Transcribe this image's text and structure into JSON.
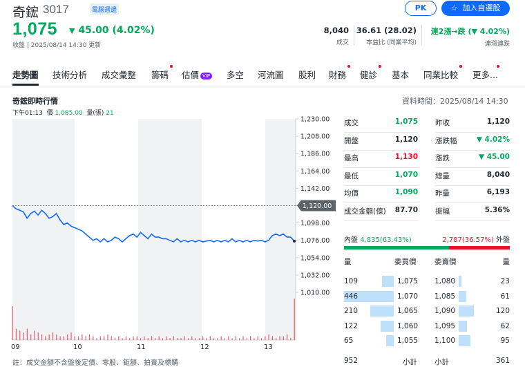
{
  "header": {
    "name": "奇鋐",
    "code": "3017",
    "tag": "電腦週邊",
    "pk_label": "PK",
    "watch_label": "加入自選股",
    "price": "1,075",
    "change": "45.00 (4.02%)",
    "update": "收盤 | 2025/08/14 14:30 更新",
    "volume_value": "8,040",
    "volume_label": "成交",
    "pe_value": "36.61 (28.02)",
    "pe_label": "本益比 (同業平均)",
    "streak_value": "連2漲→跌 (▼ 4.02%)",
    "streak_label": "連漲連跌"
  },
  "tabs": [
    "走勢圖",
    "技術分析",
    "成交彙整",
    "籌碼",
    "估價",
    "多空",
    "河流圖",
    "股利",
    "財務",
    "健診",
    "基本",
    "同業比較",
    "更多..."
  ],
  "vip_label": "VIP",
  "section": {
    "title": "奇鋐即時行情",
    "data_time": "資料時間：2025/08/14 14:30",
    "sub_time": "下午01:13",
    "sub_price_label": "價",
    "sub_price": "1,085.00",
    "sub_vol_label": "量(張)",
    "sub_vol": "21"
  },
  "chart_data": {
    "type": "line",
    "x_ticks": [
      "09",
      "10",
      "11",
      "12",
      "13"
    ],
    "y_ticks": [
      "1,230.00",
      "1,208.00",
      "1,186.00",
      "1,164.00",
      "1,142.00",
      "1,120.00",
      "1,098.00",
      "1,076.00",
      "1,054.00",
      "1,032.00",
      "1,010.00"
    ],
    "ylim": [
      1010,
      1230
    ],
    "prev_close": 1120,
    "prev_close_label": "1,120.00",
    "price_series": [
      1120,
      1116,
      1114,
      1112,
      1104,
      1110,
      1113,
      1108,
      1114,
      1110,
      1104,
      1106,
      1110,
      1102,
      1096,
      1098,
      1094,
      1092,
      1090,
      1088,
      1084,
      1080,
      1076,
      1078,
      1074,
      1078,
      1074,
      1076,
      1080,
      1078,
      1074,
      1078,
      1082,
      1084,
      1080,
      1086,
      1082,
      1078,
      1084,
      1080,
      1080,
      1078,
      1078,
      1076,
      1074,
      1078,
      1074,
      1076,
      1074,
      1076,
      1074,
      1076,
      1074,
      1075,
      1076,
      1074,
      1076,
      1074,
      1076,
      1074,
      1078,
      1074,
      1076,
      1074,
      1076,
      1074,
      1076,
      1075,
      1076,
      1074,
      1076,
      1082,
      1084,
      1082,
      1084,
      1080,
      1080,
      1075
    ],
    "volume_series": [
      18,
      6,
      5,
      4,
      6,
      3,
      5,
      4,
      3,
      2,
      3,
      4,
      3,
      2,
      2,
      3,
      4,
      2,
      2,
      3,
      2,
      3,
      2,
      1,
      2,
      2,
      3,
      2,
      1,
      2,
      1,
      2,
      1,
      2,
      2,
      1,
      2,
      1,
      2,
      1,
      2,
      1,
      2,
      1,
      2,
      1,
      1,
      2,
      1,
      2,
      1,
      1,
      2,
      1,
      2,
      1,
      1,
      2,
      1,
      2,
      1,
      2,
      1,
      2,
      1,
      2,
      1,
      2,
      1,
      2,
      3,
      2,
      1,
      2,
      2,
      3,
      1,
      22
    ]
  },
  "stats_left": [
    {
      "label": "成交",
      "value": "1,075",
      "color": "green"
    },
    {
      "label": "開盤",
      "value": "1,120",
      "color": "black"
    },
    {
      "label": "最高",
      "value": "1,130",
      "color": "red"
    },
    {
      "label": "最低",
      "value": "1,070",
      "color": "green"
    },
    {
      "label": "均價",
      "value": "1,090",
      "color": "green"
    },
    {
      "label": "成交金額(億)",
      "value": "87.70",
      "color": "black"
    }
  ],
  "stats_right": [
    {
      "label": "昨收",
      "value": "1,120",
      "color": "black"
    },
    {
      "label": "漲跌幅",
      "value": "▼ 4.02%",
      "color": "green"
    },
    {
      "label": "漲跌",
      "value": "▼ 45.00",
      "color": "green"
    },
    {
      "label": "總量",
      "value": "8,040",
      "color": "black"
    },
    {
      "label": "昨量",
      "value": "6,193",
      "color": "black"
    },
    {
      "label": "振幅",
      "value": "5.36%",
      "color": "black"
    }
  ],
  "inner_outer": {
    "inner_label": "內盤",
    "inner_value": "4,835(63.43%)",
    "outer_value": "2,787(36.57%)",
    "outer_label": "外盤",
    "inner_ratio": 0.6343
  },
  "order_book": {
    "h_bid_vol": "量",
    "h_bid_price": "委買價",
    "h_ask_price": "委賣價",
    "h_ask_vol": "量",
    "rows": [
      {
        "bid_vol": "109",
        "bid": "1,075",
        "ask": "1,080",
        "ask_vol": "23",
        "bid_ratio": 0.24,
        "ask_ratio": 0.06
      },
      {
        "bid_vol": "446",
        "bid": "1,070",
        "ask": "1,085",
        "ask_vol": "61",
        "bid_ratio": 1.0,
        "ask_ratio": 0.15
      },
      {
        "bid_vol": "210",
        "bid": "1,065",
        "ask": "1,090",
        "ask_vol": "120",
        "bid_ratio": 0.47,
        "ask_ratio": 0.3
      },
      {
        "bid_vol": "122",
        "bid": "1,060",
        "ask": "1,095",
        "ask_vol": "62",
        "bid_ratio": 0.27,
        "ask_ratio": 0.16
      },
      {
        "bid_vol": "65",
        "bid": "1,055",
        "ask": "1,100",
        "ask_vol": "95",
        "bid_ratio": 0.15,
        "ask_ratio": 0.24
      }
    ],
    "bid_total": "952",
    "bid_total_label": "小計",
    "ask_total_label": "小計",
    "ask_total": "361"
  },
  "note": "註：成交金額不含盤後定價、零股、鉅額、拍賣及標購",
  "colors": {
    "up": "#eb0f29",
    "down": "#00ab5e",
    "accent": "#0f69ff",
    "line": "#0f69ff"
  }
}
